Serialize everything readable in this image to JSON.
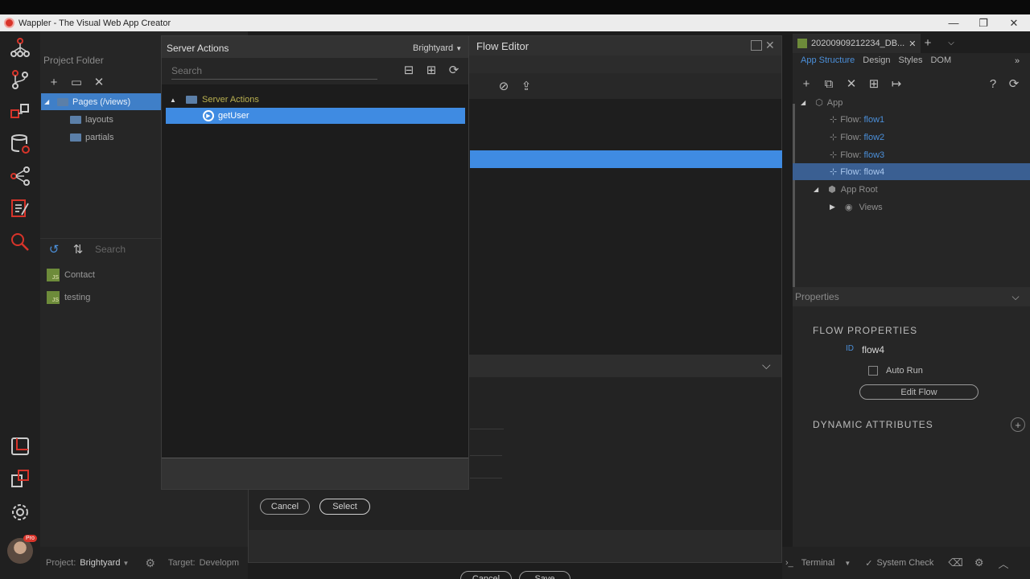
{
  "window": {
    "title": "Wappler - The Visual Web App Creator",
    "controls": {
      "minimize": "—",
      "maximize": "❐",
      "close": "✕"
    }
  },
  "project_panel": {
    "header": "Project Folder",
    "tree": [
      {
        "label": "Pages (/views)",
        "expanded": true,
        "selected": true
      },
      {
        "label": "layouts"
      },
      {
        "label": "partials"
      }
    ],
    "search_placeholder": "Search",
    "actions": [
      {
        "label": "Contact",
        "badge": "JS"
      },
      {
        "label": "testing",
        "badge": "JS"
      }
    ]
  },
  "status_left": {
    "project_label": "Project:",
    "project_value": "Brightyard",
    "target_label": "Target:",
    "target_value": "Developm"
  },
  "flow_editor": {
    "title": "Flow Editor",
    "cancel_label": "Cancel",
    "save_label": "Save"
  },
  "server_actions_dialog": {
    "title": "Server Actions",
    "project": "Brightyard",
    "search_placeholder": "Search",
    "root_label": "Server Actions",
    "items": [
      {
        "label": "getUser",
        "selected": true
      }
    ],
    "cancel_label": "Cancel",
    "select_label": "Select"
  },
  "right_panel": {
    "doc_tab": "20200909212234_DB...",
    "subtabs": [
      "App Structure",
      "Design",
      "Styles",
      "DOM"
    ],
    "active_subtab": "App Structure",
    "structure": {
      "app_label": "App",
      "flow_prefix": "Flow:",
      "flows": [
        "flow1",
        "flow2",
        "flow3",
        "flow4"
      ],
      "selected_flow": "flow4",
      "app_root": "App Root",
      "views": "Views"
    },
    "properties_label": "Properties",
    "flow_properties_label": "FLOW PROPERTIES",
    "id_label": "ID",
    "id_value": "flow4",
    "auto_run_label": "Auto Run",
    "auto_run_checked": false,
    "edit_flow_label": "Edit Flow",
    "dynamic_attributes_label": "DYNAMIC ATTRIBUTES"
  },
  "status_right": {
    "terminal_label": "Terminal",
    "system_check_label": "System Check"
  },
  "colors": {
    "accent": "#3f8be2",
    "selection_dark": "#3a5f92",
    "brand_red": "#d8342a"
  },
  "avatar_badge": "Pro"
}
